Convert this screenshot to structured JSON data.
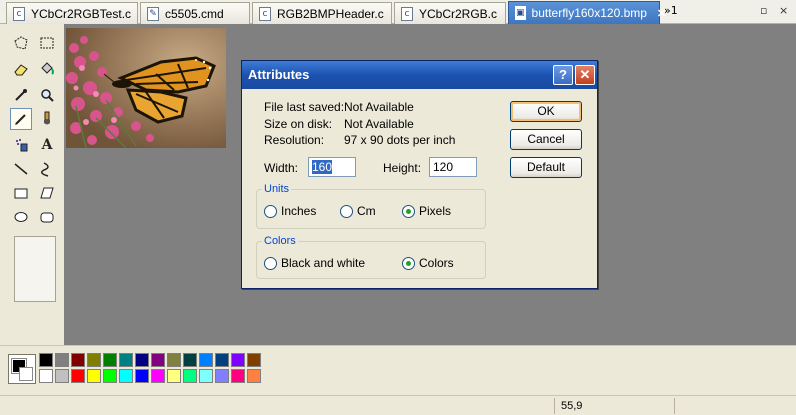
{
  "tabs": [
    {
      "label": "YCbCr2RGBTest.c",
      "icon": "c-file-icon"
    },
    {
      "label": "c5505.cmd",
      "icon": "cmd-file-icon"
    },
    {
      "label": "RGB2BMPHeader.c",
      "icon": "c-file-icon"
    },
    {
      "label": "YCbCr2RGB.c",
      "icon": "c-file-icon"
    },
    {
      "label": "butterfly160x120.bmp",
      "icon": "image-file-icon",
      "active": true
    }
  ],
  "tab_overflow": "»1",
  "window_controls": {
    "minimize": "▫",
    "close": "×"
  },
  "tools": [
    "free-select-icon",
    "rect-select-icon",
    "eraser-icon",
    "fill-bucket-icon",
    "color-picker-icon",
    "magnifier-icon",
    "pencil-icon",
    "brush-icon",
    "airbrush-icon",
    "text-icon",
    "line-icon",
    "curve-icon",
    "rectangle-icon",
    "polygon-icon",
    "ellipse-icon",
    "rounded-rect-icon"
  ],
  "tool_glyphs": [
    "⬚",
    "⬚",
    "▭",
    "⬣",
    "✎",
    "🔍",
    "✏",
    "🖌",
    "✺",
    "A",
    "╲",
    "∿",
    "▭",
    "⏢",
    "⬭",
    "▢"
  ],
  "text_tool_glyph": "A",
  "selected_tool": "pencil-icon",
  "dialog": {
    "title": "Attributes",
    "help_label": "?",
    "close_label": "✕",
    "file_last_saved_label": "File last saved:",
    "file_last_saved_value": "Not Available",
    "size_on_disk_label": "Size on disk:",
    "size_on_disk_value": "Not Available",
    "resolution_label": "Resolution:",
    "resolution_value": "97 x 90 dots per inch",
    "width_label": "Width:",
    "width_value": "160",
    "height_label": "Height:",
    "height_value": "120",
    "buttons": {
      "ok": "OK",
      "cancel": "Cancel",
      "default": "Default"
    },
    "units": {
      "title": "Units",
      "options": [
        "Inches",
        "Cm",
        "Pixels"
      ],
      "selected": "Pixels"
    },
    "colors": {
      "title": "Colors",
      "options": [
        "Black and white",
        "Colors"
      ],
      "selected": "Colors"
    }
  },
  "palette": {
    "foreground": "#000000",
    "background": "#ffffff",
    "row1": [
      "#000000",
      "#808080",
      "#800000",
      "#808000",
      "#008000",
      "#008080",
      "#000080",
      "#800080",
      "#808040",
      "#004040",
      "#0080ff",
      "#004080",
      "#8000ff",
      "#804000"
    ],
    "row2": [
      "#ffffff",
      "#c0c0c0",
      "#ff0000",
      "#ffff00",
      "#00ff00",
      "#00ffff",
      "#0000ff",
      "#ff00ff",
      "#ffff80",
      "#00ff80",
      "#80ffff",
      "#8080ff",
      "#ff0080",
      "#ff8040"
    ]
  },
  "status": {
    "coordinates": "55,9"
  }
}
